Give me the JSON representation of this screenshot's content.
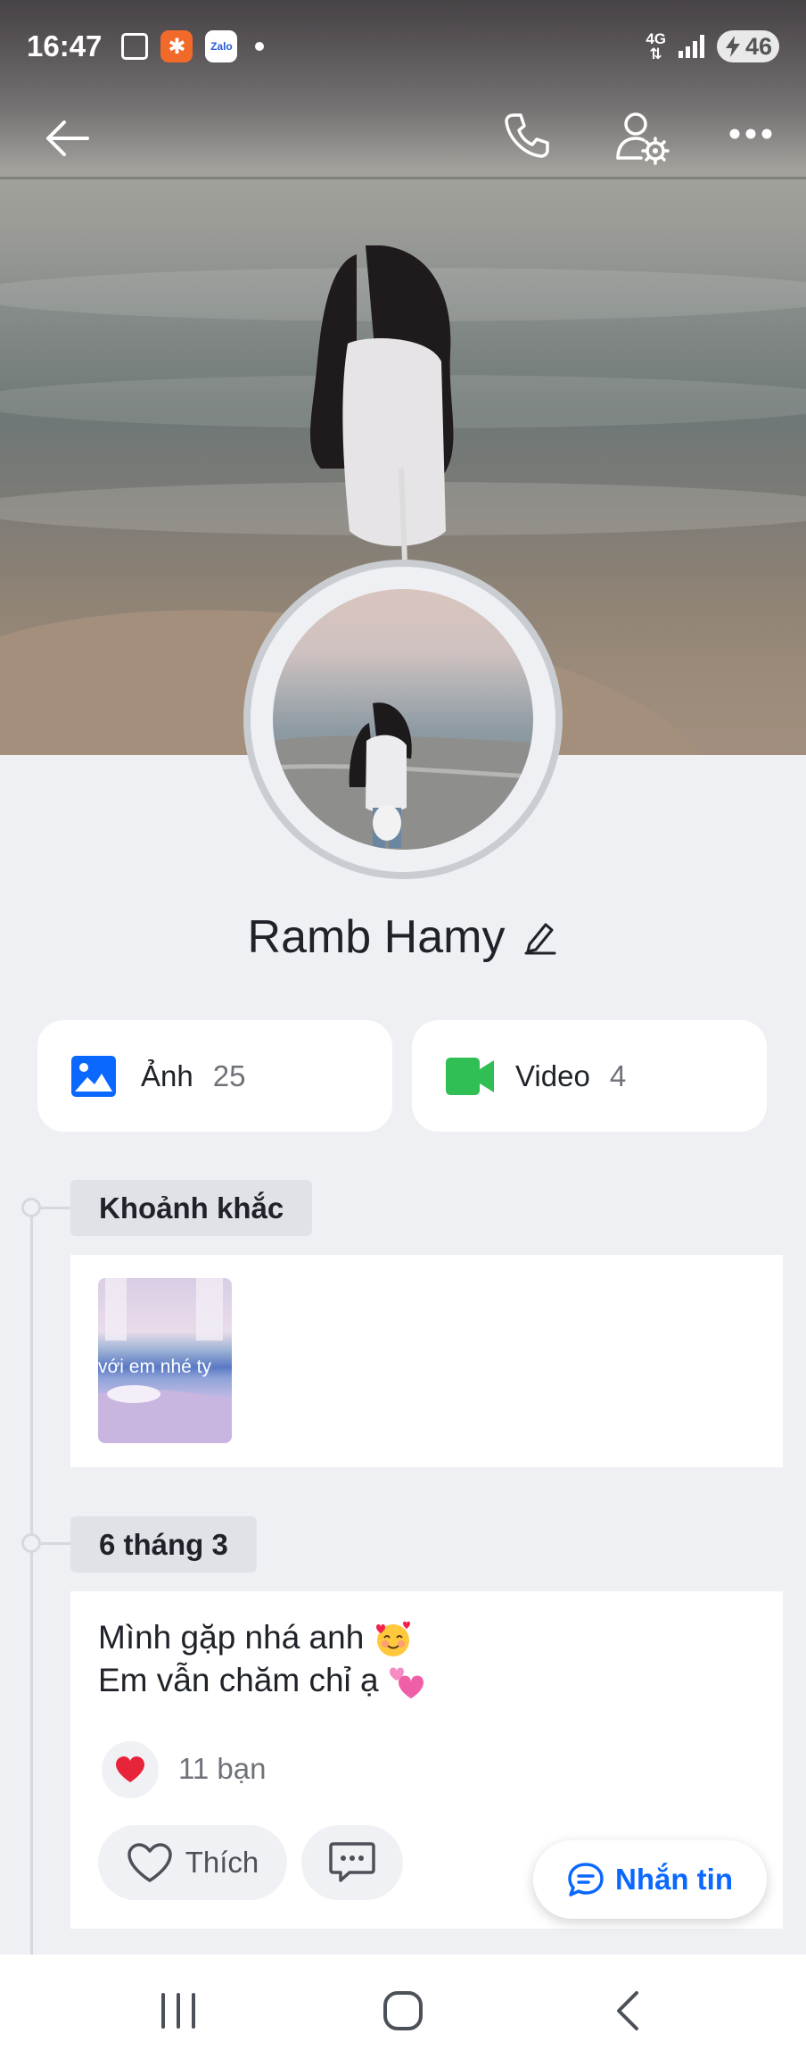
{
  "status_bar": {
    "time": "16:47",
    "network_label": "4G",
    "battery": "46",
    "zalo_label": "Zalo"
  },
  "nav": {
    "back": "back-arrow-icon",
    "call": "phone-icon",
    "settings": "user-settings-icon",
    "more": "more-dots-icon"
  },
  "profile": {
    "name": "Ramb Hamy"
  },
  "media": {
    "photos_label": "Ảnh",
    "photos_count": "25",
    "videos_label": "Video",
    "videos_count": "4"
  },
  "timeline": {
    "moments_label": "Khoảnh khắc",
    "moment_caption": "với em nhé ty",
    "post_date": "6 tháng 3",
    "post_line1": "Mình gặp nhá anh",
    "post_line2": "Em vẫn chăm chỉ ạ",
    "reaction_count": "11 bạn",
    "like_label": "Thích"
  },
  "fab": {
    "label": "Nhắn tin"
  },
  "colors": {
    "accent": "#0a68ff",
    "photo_icon": "#0a68ff",
    "video_icon": "#2fbf55",
    "heart": "#e8243a",
    "background": "#eef0f4"
  }
}
